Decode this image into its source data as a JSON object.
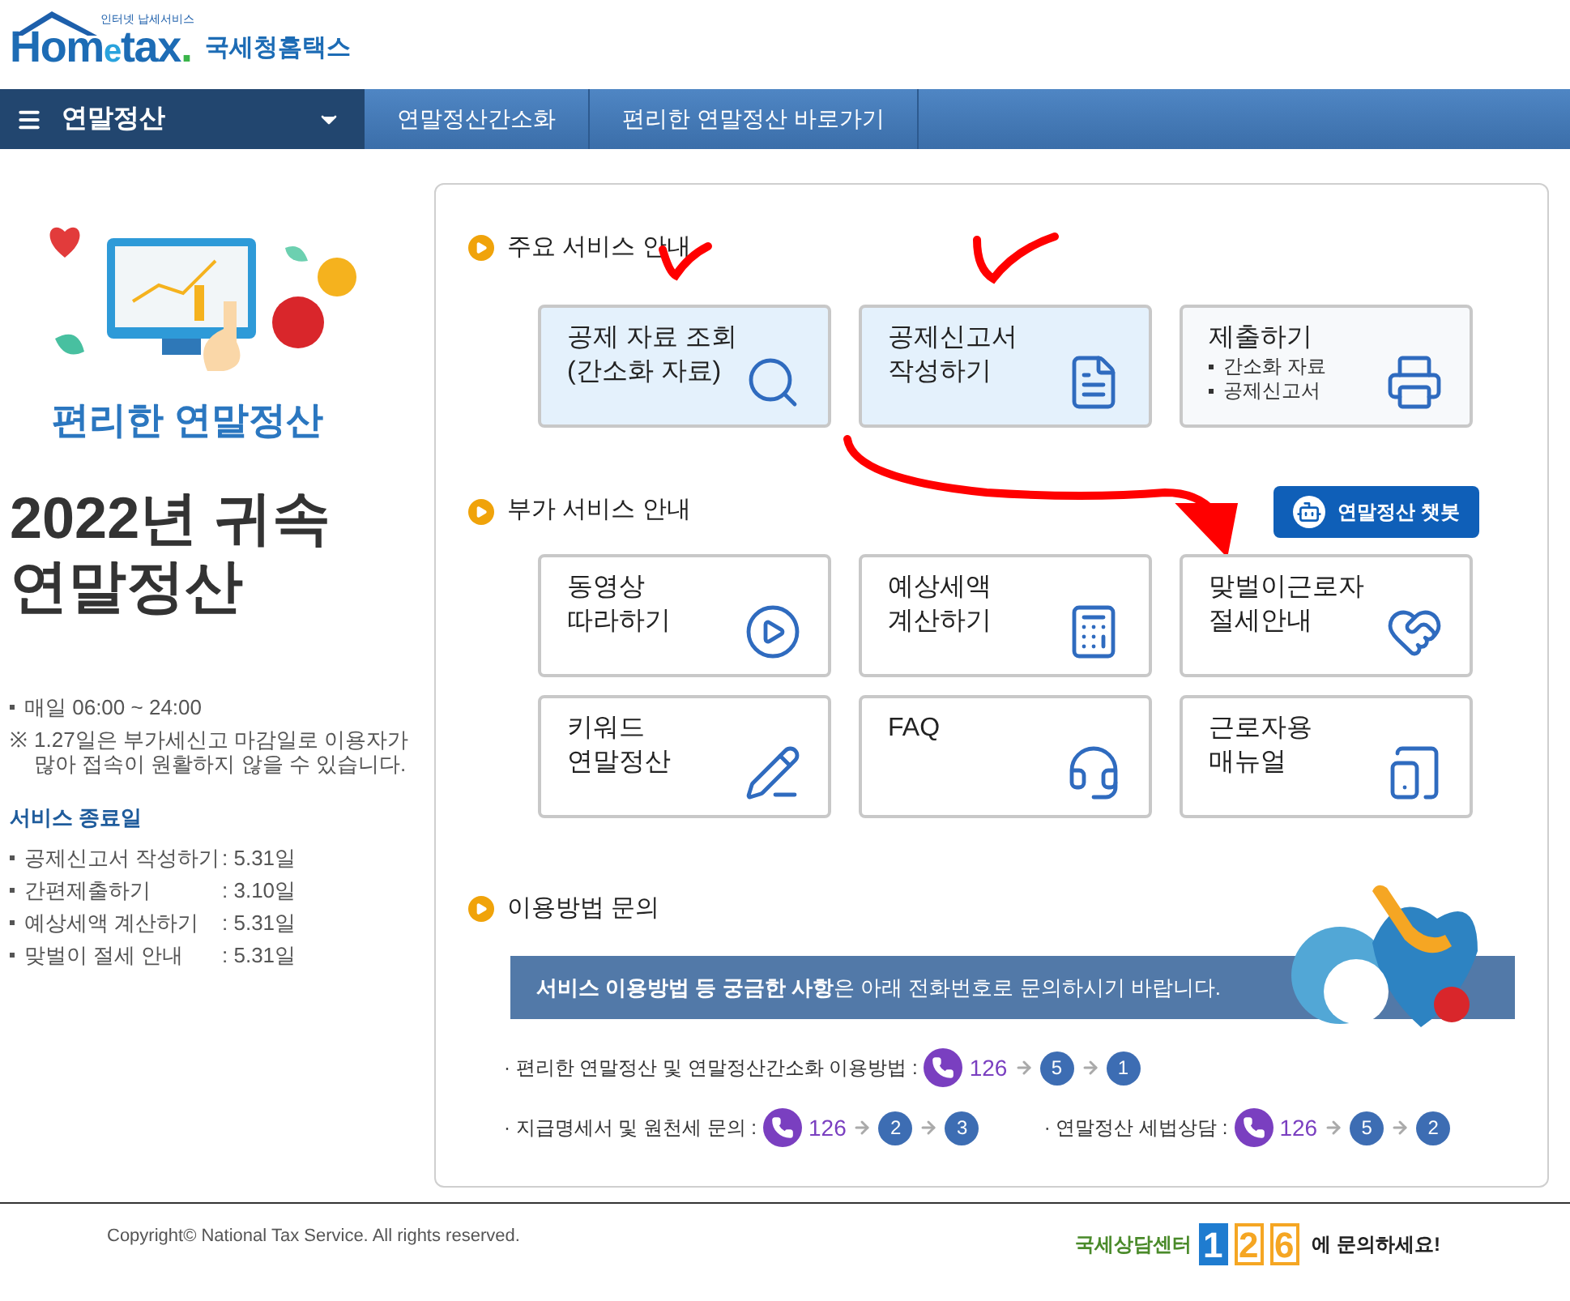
{
  "header": {
    "logo": {
      "tagline": "인터넷 납세서비스",
      "word": [
        "Hom",
        "e",
        "tax",
        "."
      ],
      "name": "국세청홈택스"
    }
  },
  "nav": {
    "menu": "연말정산",
    "links": [
      "연말정산간소화",
      "편리한 연말정산 바로가기"
    ]
  },
  "intro": {
    "banner_title": "편리한 연말정산",
    "heading": [
      "2022년 귀속",
      "연말정산"
    ],
    "hours": "매일 06:00  ~ 24:00",
    "notice_mark": "※",
    "notice": "1.27일은 부가세신고 마감일로 이용자가 많아 접속이 원활하지 않을 수 있습니다.",
    "end_dates": {
      "title": "서비스 종료일",
      "items": [
        {
          "label": "공제신고서 작성하기",
          "date": ": 5.31일"
        },
        {
          "label": "간편제출하기",
          "date": ": 3.10일"
        },
        {
          "label": "예상세액 계산하기",
          "date": ": 5.31일"
        },
        {
          "label": "맞벌이 절세 안내",
          "date": ": 5.31일"
        }
      ]
    }
  },
  "main_services": {
    "title": "주요 서비스 안내",
    "cards": [
      {
        "lines": [
          "공제 자료 조회",
          "(간소화 자료)"
        ],
        "kind": "search",
        "highlighted": true
      },
      {
        "lines": [
          "공제신고서",
          "작성하기"
        ],
        "kind": "document",
        "highlighted": true
      },
      {
        "lines": [
          "제출하기"
        ],
        "bullets": [
          "간소화 자료",
          "공제신고서"
        ],
        "kind": "printer",
        "highlighted": false
      }
    ]
  },
  "extra_services": {
    "title": "부가 서비스 안내",
    "chatbot": "연말정산 챗봇",
    "cards": [
      {
        "lines": [
          "동영상",
          "따라하기"
        ],
        "kind": "play"
      },
      {
        "lines": [
          "예상세액",
          "계산하기"
        ],
        "kind": "calculator"
      },
      {
        "lines": [
          "맞벌이근로자",
          "절세안내"
        ],
        "kind": "heart"
      },
      {
        "lines": [
          "키워드",
          "연말정산"
        ],
        "kind": "pencil"
      },
      {
        "lines": [
          "FAQ"
        ],
        "kind": "headset"
      },
      {
        "lines": [
          "근로자용",
          "매뉴얼"
        ],
        "kind": "tablet"
      }
    ]
  },
  "contact": {
    "title": "이용방법 문의",
    "banner": "**서비스 이용방법 등 궁금한 사항**은 아래 전화번호로 문의하시기 바랍니다.",
    "rows": [
      [
        {
          "label": "· 편리한 연말정산 및 연말정산간소화 이용방법 :",
          "number": "126",
          "steps": [
            "5",
            "1"
          ]
        }
      ],
      [
        {
          "label": "· 지급명세서  및 원천세 문의 :",
          "number": "126",
          "steps": [
            "2",
            "3"
          ]
        },
        {
          "label": "· 연말정산 세법상담  :",
          "number": "126",
          "steps": [
            "5",
            "2"
          ]
        }
      ]
    ]
  },
  "footer": {
    "copyright": "Copyright© National Tax Service. All rights reserved.",
    "center": "국세상담센터",
    "digits": [
      "1",
      "2",
      "6"
    ],
    "suffix": "에 문의하세요!"
  }
}
